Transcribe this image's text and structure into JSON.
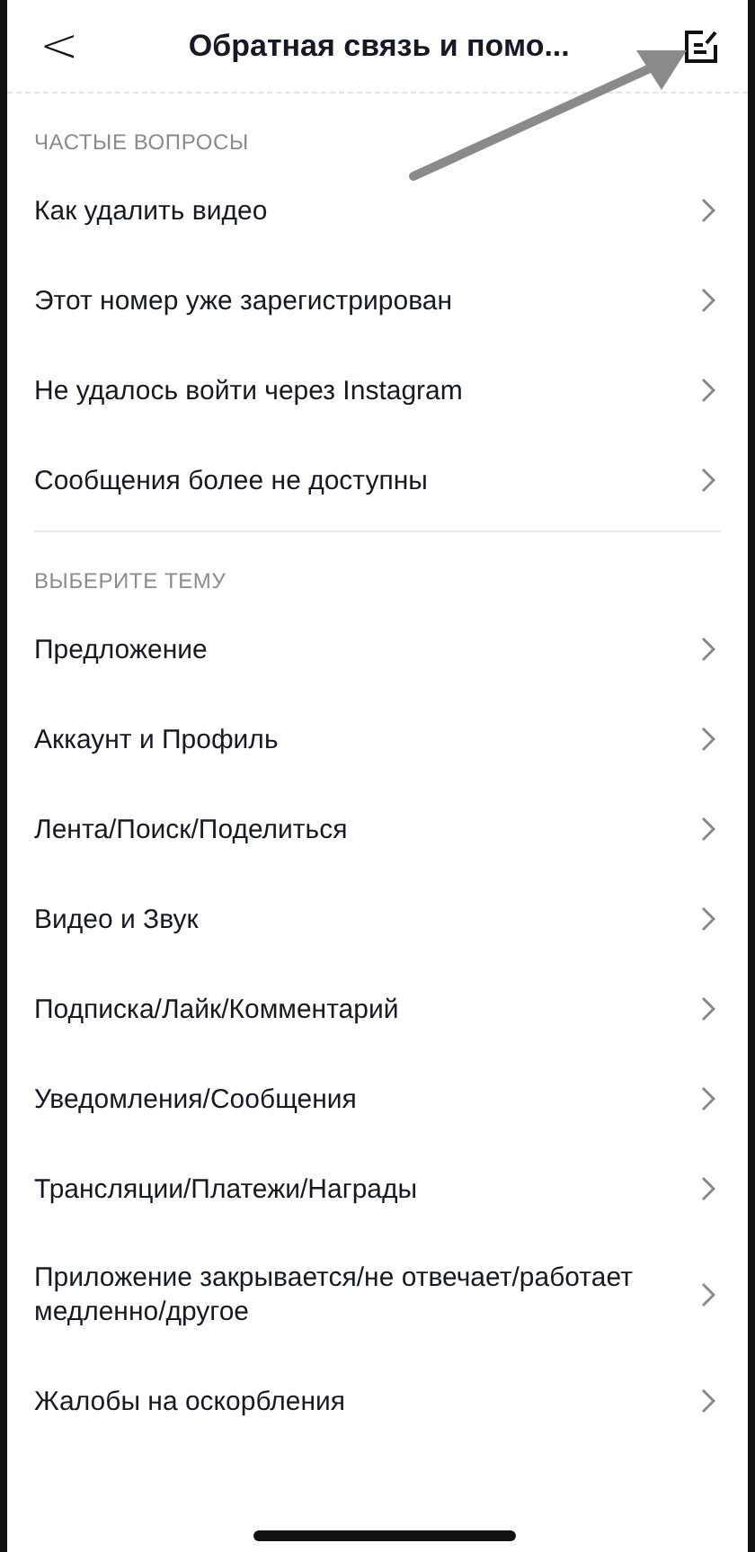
{
  "header": {
    "back": "<",
    "title": "Обратная связь и помо..."
  },
  "sections": [
    {
      "heading": "ЧАСТЫЕ ВОПРОСЫ",
      "items": [
        {
          "label": "Как удалить видео"
        },
        {
          "label": "Этот номер уже зарегистрирован"
        },
        {
          "label": "Не удалось войти через Instagram"
        },
        {
          "label": "Сообщения более не доступны"
        }
      ]
    },
    {
      "heading": "ВЫБЕРИТЕ ТЕМУ",
      "items": [
        {
          "label": "Предложение"
        },
        {
          "label": "Аккаунт и Профиль"
        },
        {
          "label": "Лента/Поиск/Поделиться"
        },
        {
          "label": "Видео и Звук"
        },
        {
          "label": "Подписка/Лайк/Комментарий"
        },
        {
          "label": "Уведомления/Сообщения"
        },
        {
          "label": "Трансляции/Платежи/Награды"
        },
        {
          "label": "Приложение закрывается/не отвечает/работает медленно/другое"
        },
        {
          "label": "Жалобы на оскорбления"
        }
      ]
    }
  ]
}
